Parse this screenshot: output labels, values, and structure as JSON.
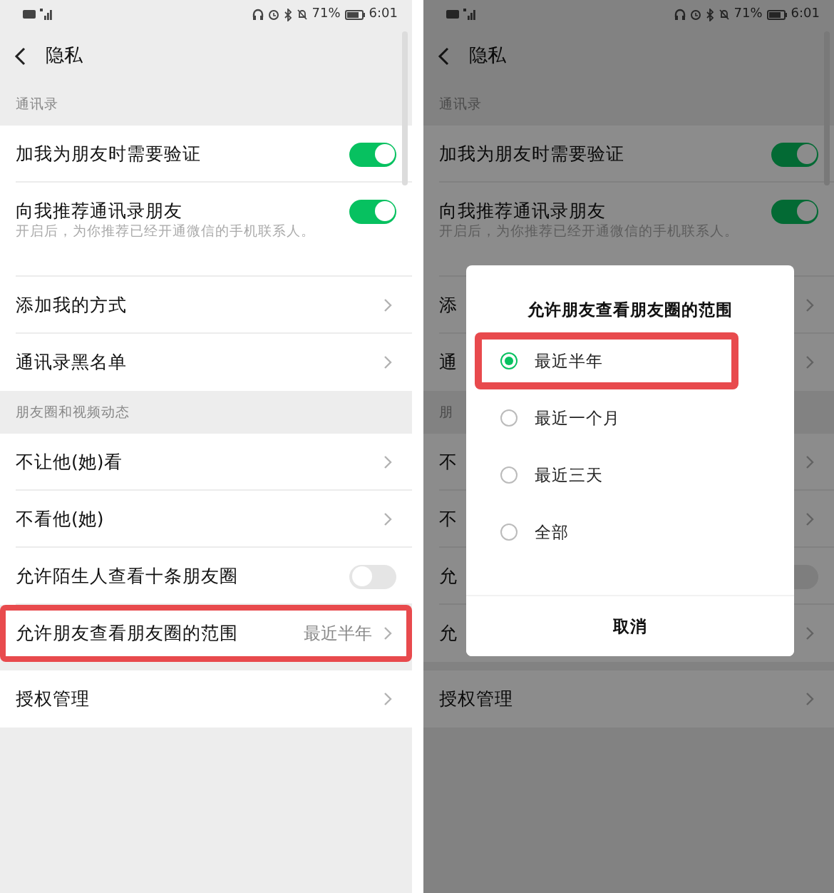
{
  "screens": [
    {
      "status_bar": {
        "battery": "71%",
        "time": "6:01"
      },
      "title": "隐私",
      "dimmed": false,
      "sections": [
        {
          "label": "通讯录",
          "rows": [
            {
              "kind": "toggle",
              "label": "加我为朋友时需要验证",
              "on": true
            },
            {
              "kind": "toggle",
              "label": "向我推荐通讯录朋友",
              "on": true,
              "description": "开启后，为你推荐已经开通微信的手机联系人。"
            },
            {
              "kind": "link",
              "label": "添加我的方式"
            },
            {
              "kind": "link",
              "label": "通讯录黑名单"
            }
          ]
        },
        {
          "label": "朋友圈和视频动态",
          "rows": [
            {
              "kind": "link",
              "label": "不让他(她)看"
            },
            {
              "kind": "link",
              "label": "不看他(她)"
            },
            {
              "kind": "toggle",
              "label": "允许陌生人查看十条朋友圈",
              "on": false
            },
            {
              "kind": "link",
              "label": "允许朋友查看朋友圈的范围",
              "value": "最近半年",
              "highlighted": true
            }
          ]
        },
        {
          "rows": [
            {
              "kind": "link",
              "label": "授权管理"
            }
          ]
        }
      ]
    },
    {
      "status_bar": {
        "battery": "71%",
        "time": "6:01"
      },
      "title": "隐私",
      "dimmed": true,
      "sections": [
        {
          "label": "通讯录",
          "rows": [
            {
              "kind": "toggle",
              "label": "加我为朋友时需要验证",
              "on": true
            },
            {
              "kind": "toggle",
              "label": "向我推荐通讯录朋友",
              "on": true,
              "description": "开启后，为你推荐已经开通微信的手机联系人。"
            },
            {
              "kind": "link",
              "label": "添"
            },
            {
              "kind": "link",
              "label": "通"
            }
          ]
        },
        {
          "label": "朋",
          "rows": [
            {
              "kind": "link",
              "label": "不"
            },
            {
              "kind": "link",
              "label": "不"
            },
            {
              "kind": "toggle",
              "label": "允",
              "on": false
            },
            {
              "kind": "link",
              "label": "允"
            }
          ]
        },
        {
          "rows": [
            {
              "kind": "link",
              "label": "授权管理"
            }
          ]
        }
      ],
      "dialog": {
        "title": "允许朋友查看朋友圈的范围",
        "options": [
          {
            "label": "最近半年",
            "selected": true,
            "highlighted": true
          },
          {
            "label": "最近一个月",
            "selected": false
          },
          {
            "label": "最近三天",
            "selected": false
          },
          {
            "label": "全部",
            "selected": false
          }
        ],
        "cancel": "取消"
      }
    }
  ]
}
